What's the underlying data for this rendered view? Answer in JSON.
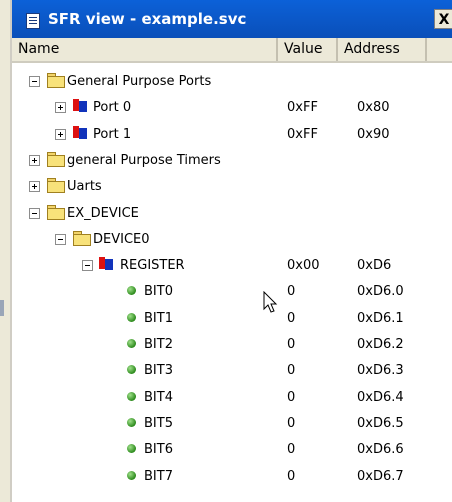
{
  "window": {
    "title": "SFR view - example.svc",
    "close_label": "X"
  },
  "columns": {
    "name": "Name",
    "value": "Value",
    "address": "Address"
  },
  "tree": [
    {
      "indent": 0,
      "expander": "minus",
      "icon": "folder",
      "label": "General Purpose Ports",
      "value": "",
      "address": ""
    },
    {
      "indent": 1,
      "expander": "plus",
      "icon": "port",
      "label": "Port 0",
      "value": "0xFF",
      "address": "0x80"
    },
    {
      "indent": 1,
      "expander": "plus",
      "icon": "port",
      "label": "Port 1",
      "value": "0xFF",
      "address": "0x90"
    },
    {
      "indent": 0,
      "expander": "plus",
      "icon": "folder",
      "label": "general Purpose Timers",
      "value": "",
      "address": ""
    },
    {
      "indent": 0,
      "expander": "plus",
      "icon": "folder",
      "label": "Uarts",
      "value": "",
      "address": ""
    },
    {
      "indent": 0,
      "expander": "minus",
      "icon": "folder",
      "label": "EX_DEVICE",
      "value": "",
      "address": ""
    },
    {
      "indent": 1,
      "expander": "minus",
      "icon": "folder",
      "label": "DEVICE0",
      "value": "",
      "address": ""
    },
    {
      "indent": 2,
      "expander": "minus",
      "icon": "port",
      "label": "REGISTER",
      "value": "0x00",
      "address": "0xD6"
    },
    {
      "indent": 3,
      "expander": "none",
      "icon": "bit",
      "label": "BIT0",
      "value": "0",
      "address": "0xD6.0"
    },
    {
      "indent": 3,
      "expander": "none",
      "icon": "bit",
      "label": "BIT1",
      "value": "0",
      "address": "0xD6.1"
    },
    {
      "indent": 3,
      "expander": "none",
      "icon": "bit",
      "label": "BIT2",
      "value": "0",
      "address": "0xD6.2"
    },
    {
      "indent": 3,
      "expander": "none",
      "icon": "bit",
      "label": "BIT3",
      "value": "0",
      "address": "0xD6.3"
    },
    {
      "indent": 3,
      "expander": "none",
      "icon": "bit",
      "label": "BIT4",
      "value": "0",
      "address": "0xD6.4"
    },
    {
      "indent": 3,
      "expander": "none",
      "icon": "bit",
      "label": "BIT5",
      "value": "0",
      "address": "0xD6.5"
    },
    {
      "indent": 3,
      "expander": "none",
      "icon": "bit",
      "label": "BIT6",
      "value": "0",
      "address": "0xD6.6"
    },
    {
      "indent": 3,
      "expander": "none",
      "icon": "bit",
      "label": "BIT7",
      "value": "0",
      "address": "0xD6.7"
    }
  ]
}
